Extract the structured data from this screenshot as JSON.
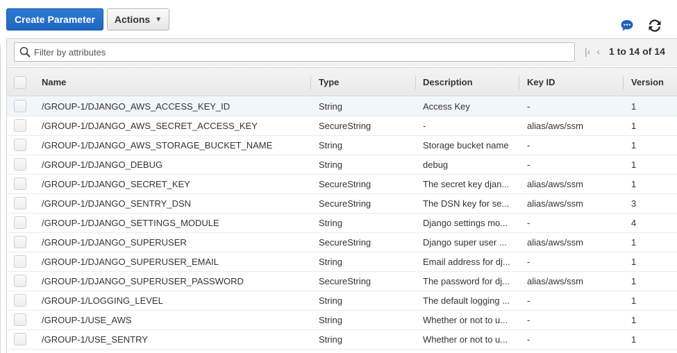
{
  "toolbar": {
    "create_label": "Create Parameter",
    "actions_label": "Actions",
    "chat_icon": "chat-bubble-icon",
    "refresh_icon": "refresh-icon",
    "accent_color": "#2366c4"
  },
  "filter": {
    "placeholder": "Filter by attributes",
    "value": ""
  },
  "pagination": {
    "range_label": "1 to 14 of 14"
  },
  "table": {
    "columns": {
      "name": "Name",
      "type": "Type",
      "description": "Description",
      "key_id": "Key ID",
      "version": "Version"
    },
    "rows": [
      {
        "name": "/GROUP-1/DJANGO_AWS_ACCESS_KEY_ID",
        "type": "String",
        "description": "Access Key",
        "key_id": "-",
        "version": "1"
      },
      {
        "name": "/GROUP-1/DJANGO_AWS_SECRET_ACCESS_KEY",
        "type": "SecureString",
        "description": "-",
        "key_id": "alias/aws/ssm",
        "version": "1"
      },
      {
        "name": "/GROUP-1/DJANGO_AWS_STORAGE_BUCKET_NAME",
        "type": "String",
        "description": "Storage bucket name",
        "key_id": "-",
        "version": "1"
      },
      {
        "name": "/GROUP-1/DJANGO_DEBUG",
        "type": "String",
        "description": "debug",
        "key_id": "-",
        "version": "1"
      },
      {
        "name": "/GROUP-1/DJANGO_SECRET_KEY",
        "type": "SecureString",
        "description": "The secret key djan...",
        "key_id": "alias/aws/ssm",
        "version": "1"
      },
      {
        "name": "/GROUP-1/DJANGO_SENTRY_DSN",
        "type": "SecureString",
        "description": "The DSN key for se...",
        "key_id": "alias/aws/ssm",
        "version": "3"
      },
      {
        "name": "/GROUP-1/DJANGO_SETTINGS_MODULE",
        "type": "String",
        "description": "Django settings mo...",
        "key_id": "-",
        "version": "4"
      },
      {
        "name": "/GROUP-1/DJANGO_SUPERUSER",
        "type": "SecureString",
        "description": "Django super user ...",
        "key_id": "alias/aws/ssm",
        "version": "1"
      },
      {
        "name": "/GROUP-1/DJANGO_SUPERUSER_EMAIL",
        "type": "String",
        "description": "Email address for dj...",
        "key_id": "-",
        "version": "1"
      },
      {
        "name": "/GROUP-1/DJANGO_SUPERUSER_PASSWORD",
        "type": "SecureString",
        "description": "The password for dj...",
        "key_id": "alias/aws/ssm",
        "version": "1"
      },
      {
        "name": "/GROUP-1/LOGGING_LEVEL",
        "type": "String",
        "description": "The default logging ...",
        "key_id": "-",
        "version": "1"
      },
      {
        "name": "/GROUP-1/USE_AWS",
        "type": "String",
        "description": "Whether or not to u...",
        "key_id": "-",
        "version": "1"
      },
      {
        "name": "/GROUP-1/USE_SENTRY",
        "type": "String",
        "description": "Whether or not to u...",
        "key_id": "-",
        "version": "1"
      }
    ]
  }
}
